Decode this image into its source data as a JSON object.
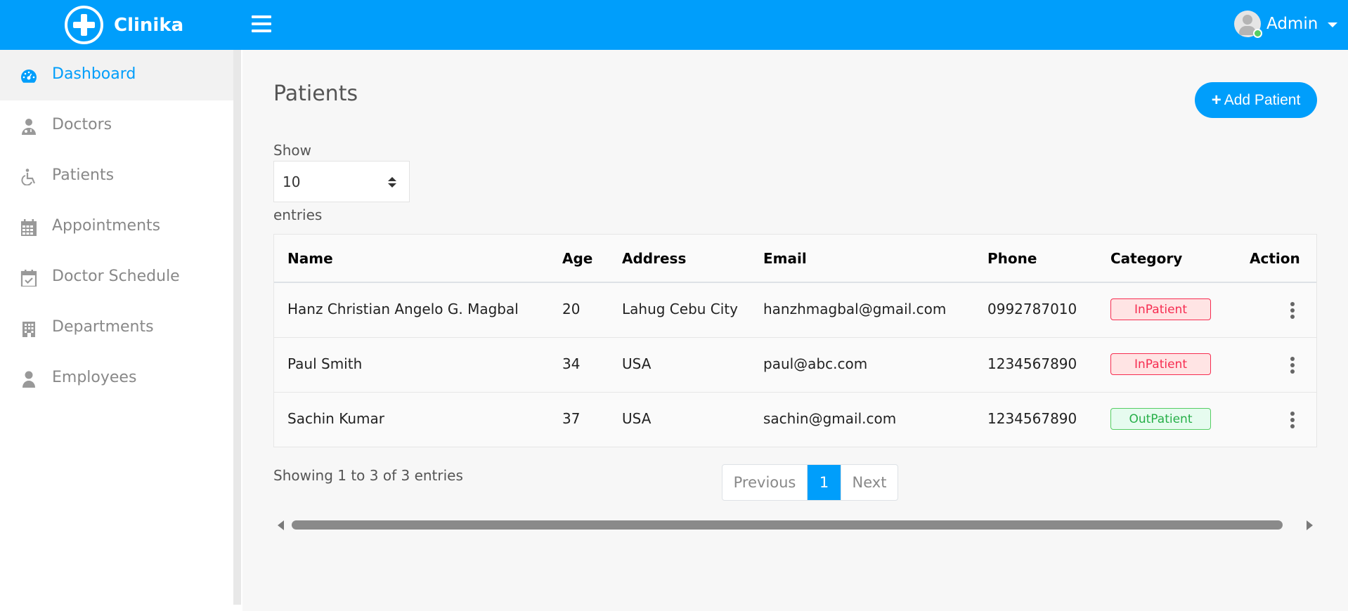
{
  "app": {
    "name": "Clinika"
  },
  "header": {
    "user_name": "Admin"
  },
  "sidebar": {
    "active_color": "#009efb",
    "items": [
      {
        "label": "Dashboard",
        "icon": "dashboard-icon",
        "active": true
      },
      {
        "label": "Doctors",
        "icon": "doctor-icon"
      },
      {
        "label": "Patients",
        "icon": "wheelchair-icon"
      },
      {
        "label": "Appointments",
        "icon": "calendar-icon"
      },
      {
        "label": "Doctor Schedule",
        "icon": "calendar-check-icon"
      },
      {
        "label": "Departments",
        "icon": "hospital-icon"
      },
      {
        "label": "Employees",
        "icon": "user-icon"
      }
    ]
  },
  "main": {
    "title": "Patients",
    "add_button": "Add Patient",
    "show_label": "Show",
    "entries_value": "10",
    "entries_label": "entries",
    "columns": [
      "Name",
      "Age",
      "Address",
      "Email",
      "Phone",
      "Category",
      "Action"
    ],
    "rows": [
      {
        "name": "Hanz Christian Angelo G. Magbal",
        "age": "20",
        "address": "Lahug Cebu City",
        "email": "hanzhmagbal@gmail.com",
        "phone": "0992787010",
        "category": "InPatient"
      },
      {
        "name": "Paul Smith",
        "age": "34",
        "address": "USA",
        "email": "paul@abc.com",
        "phone": "1234567890",
        "category": "InPatient"
      },
      {
        "name": "Sachin Kumar",
        "age": "37",
        "address": "USA",
        "email": "sachin@gmail.com",
        "phone": "1234567890",
        "category": "OutPatient"
      }
    ],
    "info": "Showing 1 to 3 of 3 entries",
    "pagination": {
      "previous": "Previous",
      "current": "1",
      "next": "Next"
    }
  },
  "colors": {
    "primary": "#009efb",
    "danger": "#f62d51",
    "success": "#55ce63"
  }
}
